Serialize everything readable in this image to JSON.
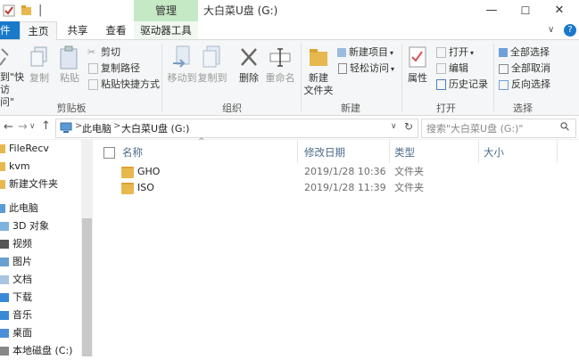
{
  "titlebar": {
    "context_tab": "管理",
    "window_title": "大白菜U盘 (G:)",
    "pin_glyph": "|",
    "minimize": "—",
    "maximize": "☐",
    "close": "✕"
  },
  "tabs": {
    "file": "件",
    "home": "主页",
    "share": "共享",
    "view": "查看",
    "drive_tools": "驱动器工具",
    "collapse": "∨",
    "help": "?"
  },
  "ribbon": {
    "clipboard": {
      "pin_label_1": "到\"快",
      "pin_label_2": "访问\"",
      "copy": "复制",
      "paste": "粘贴",
      "cut": "剪切",
      "copy_path": "复制路径",
      "paste_shortcut": "粘贴快捷方式",
      "group": "剪贴板"
    },
    "organize": {
      "move_to": "移动到",
      "copy_to": "复制到",
      "delete": "删除",
      "rename": "重命名",
      "group": "组织"
    },
    "new": {
      "new_folder_1": "新建",
      "new_folder_2": "文件夹",
      "new_item": "新建项目",
      "easy_access": "轻松访问",
      "group": "新建"
    },
    "open": {
      "properties": "属性",
      "open": "打开",
      "edit": "编辑",
      "history": "历史记录",
      "group": "打开"
    },
    "select": {
      "select_all": "全部选择",
      "select_none": "全部取消",
      "invert": "反向选择",
      "group": "选择"
    }
  },
  "address": {
    "back": "←",
    "forward": "→",
    "recent": "∨",
    "up": "↑",
    "crumb_root_arrow": ">",
    "crumb_pc": "此电脑",
    "crumb_arrow": ">",
    "crumb_drive": "大白菜U盘 (G:)",
    "dropdown": "∨",
    "refresh": "↻",
    "search_placeholder": "搜索\"大白菜U盘 (G:)\"",
    "search_icon": "⚲"
  },
  "nav": {
    "items": [
      {
        "label": "FileRecv",
        "icon": "folder-icon"
      },
      {
        "label": "kvm",
        "icon": "folder-icon"
      },
      {
        "label": "新建文件夹",
        "icon": "folder-icon"
      },
      {
        "label": "此电脑",
        "icon": "pc-icon"
      },
      {
        "label": "3D 对象",
        "icon": "3d-icon"
      },
      {
        "label": "视频",
        "icon": "video-icon"
      },
      {
        "label": "图片",
        "icon": "picture-icon"
      },
      {
        "label": "文档",
        "icon": "document-icon"
      },
      {
        "label": "下载",
        "icon": "download-icon"
      },
      {
        "label": "音乐",
        "icon": "music-icon"
      },
      {
        "label": "桌面",
        "icon": "desktop-icon"
      },
      {
        "label": "本地磁盘 (C:)",
        "icon": "drive-icon"
      }
    ]
  },
  "columns": {
    "name": "名称",
    "modified": "修改日期",
    "type": "类型",
    "size": "大小",
    "sort_glyph": "^"
  },
  "files": [
    {
      "name": "GHO",
      "modified": "2019/1/28 10:36",
      "type": "文件夹",
      "size": ""
    },
    {
      "name": "ISO",
      "modified": "2019/1/28 11:39",
      "type": "文件夹",
      "size": ""
    }
  ],
  "colors": {
    "accent": "#1979ca",
    "context_tab": "#c5e8c5",
    "folder": "#e7b84d"
  }
}
